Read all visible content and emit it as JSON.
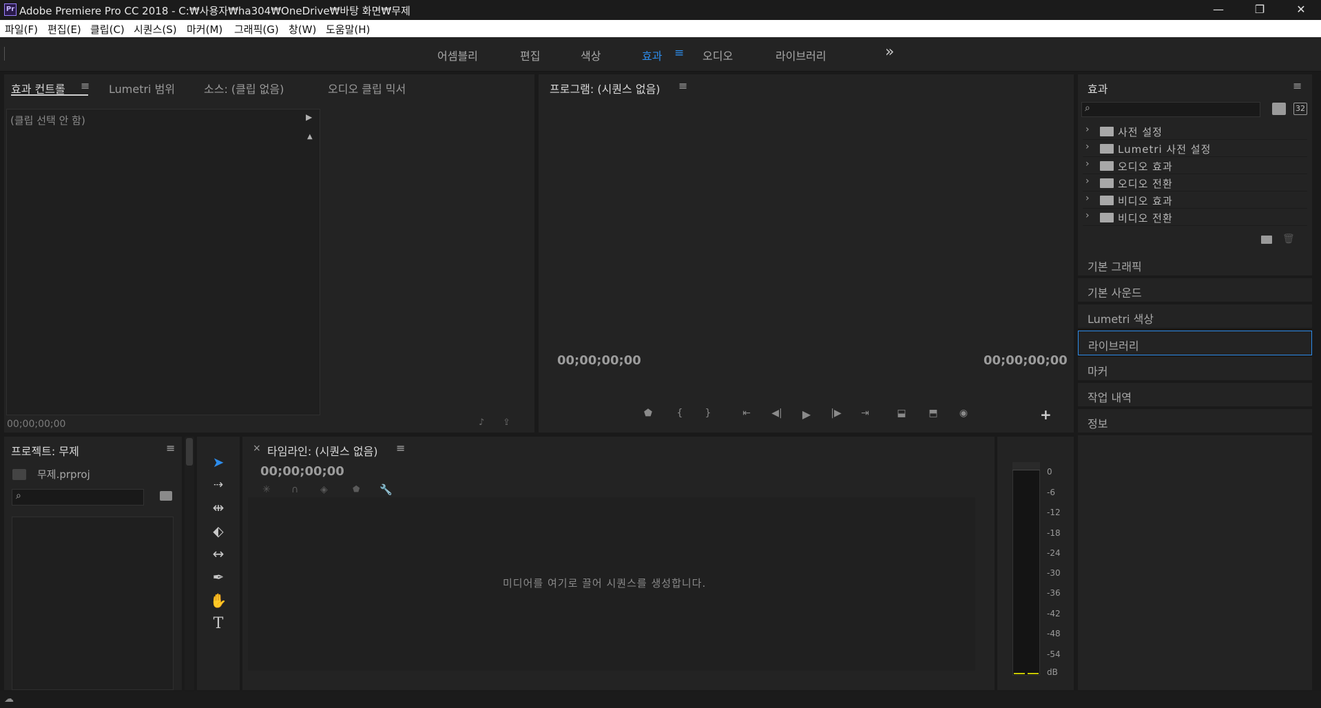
{
  "titlebar": {
    "app_icon": "Pr",
    "title": "Adobe Premiere Pro CC 2018 - C:₩사용자₩ha304₩OneDrive₩바탕 화면₩무제",
    "minimize": "—",
    "restore": "❐",
    "close": "✕"
  },
  "menu": [
    "파일(F)",
    "편집(E)",
    "클립(C)",
    "시퀀스(S)",
    "마커(M)",
    "그래픽(G)",
    "창(W)",
    "도움말(H)"
  ],
  "workspaces": {
    "items": [
      "어셈블리",
      "편집",
      "색상",
      "효과",
      "오디오",
      "라이브러리"
    ],
    "active": "효과",
    "overflow": "»"
  },
  "source_panel": {
    "tabs": [
      "효과 컨트롤",
      "Lumetri 범위",
      "소스: (클립 없음)",
      "오디오 클립 믹서"
    ],
    "no_clip": "(클립 선택 안 함)",
    "timecode": "00;00;00;00"
  },
  "program_panel": {
    "title": "프로그램: (시퀀스 없음)",
    "tc_left": "00;00;00;00",
    "tc_right": "00;00;00;00",
    "controls": [
      "marker-icon",
      "mark-in-icon",
      "mark-out-icon",
      "go-to-in-icon",
      "step-back-icon",
      "play-icon",
      "step-forward-icon",
      "go-to-out-icon",
      "lift-icon",
      "extract-icon",
      "export-frame-icon"
    ],
    "add": "+"
  },
  "effects_panel": {
    "title": "효과",
    "badge": "32",
    "tree": [
      "사전 설정",
      "Lumetri 사전 설정",
      "오디오 효과",
      "오디오 전환",
      "비디오 효과",
      "비디오 전환"
    ]
  },
  "stacked_panels": [
    "기본 그래픽",
    "기본 사운드",
    "Lumetri 색상",
    "라이브러리",
    "마커",
    "작업 내역",
    "정보"
  ],
  "stacked_active": "라이브러리",
  "project_panel": {
    "title": "프로젝트: 무제",
    "file": "무제.prproj"
  },
  "timeline_panel": {
    "close": "×",
    "title": "타임라인: (시퀀스 없음)",
    "timecode": "00;00;00;00",
    "drop_hint": "미디어를 여기로 끌어 시퀀스를 생성합니다."
  },
  "audio_meter": {
    "labels": [
      "0",
      "-6",
      "-12",
      "-18",
      "-24",
      "-30",
      "-36",
      "-42",
      "-48",
      "-54",
      "dB"
    ]
  },
  "colors": {
    "accent": "#2d8ceb",
    "panel_bg": "#232323",
    "app_bg": "#1a1a1a"
  }
}
